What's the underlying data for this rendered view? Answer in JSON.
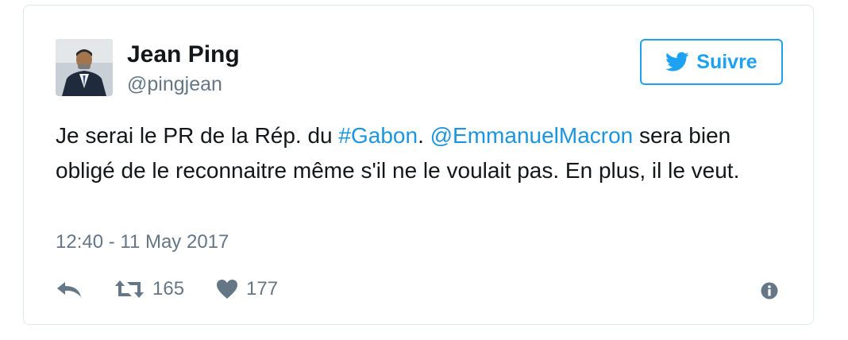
{
  "user": {
    "name": "Jean Ping",
    "handle": "@pingjean",
    "avatar_icon": "profile-photo"
  },
  "follow": {
    "label": "Suivre",
    "icon": "twitter-bird-icon",
    "color": "#1da1f2"
  },
  "tweet": {
    "text_1": "Je serai le PR de la Rép. du ",
    "hashtag": "#Gabon",
    "text_2": ". ",
    "mention": "@EmmanuelMacron",
    "text_3": " sera bien obligé de le reconnaitre même s'il ne le voulait pas. En plus, il le veut.",
    "link_color": "#1b95e0"
  },
  "timestamp": "12:40 - 11 May 2017",
  "actions": {
    "reply_icon": "reply-icon",
    "retweet_icon": "retweet-icon",
    "retweet_count": "165",
    "like_icon": "heart-icon",
    "like_count": "177",
    "info_icon": "info-icon"
  }
}
